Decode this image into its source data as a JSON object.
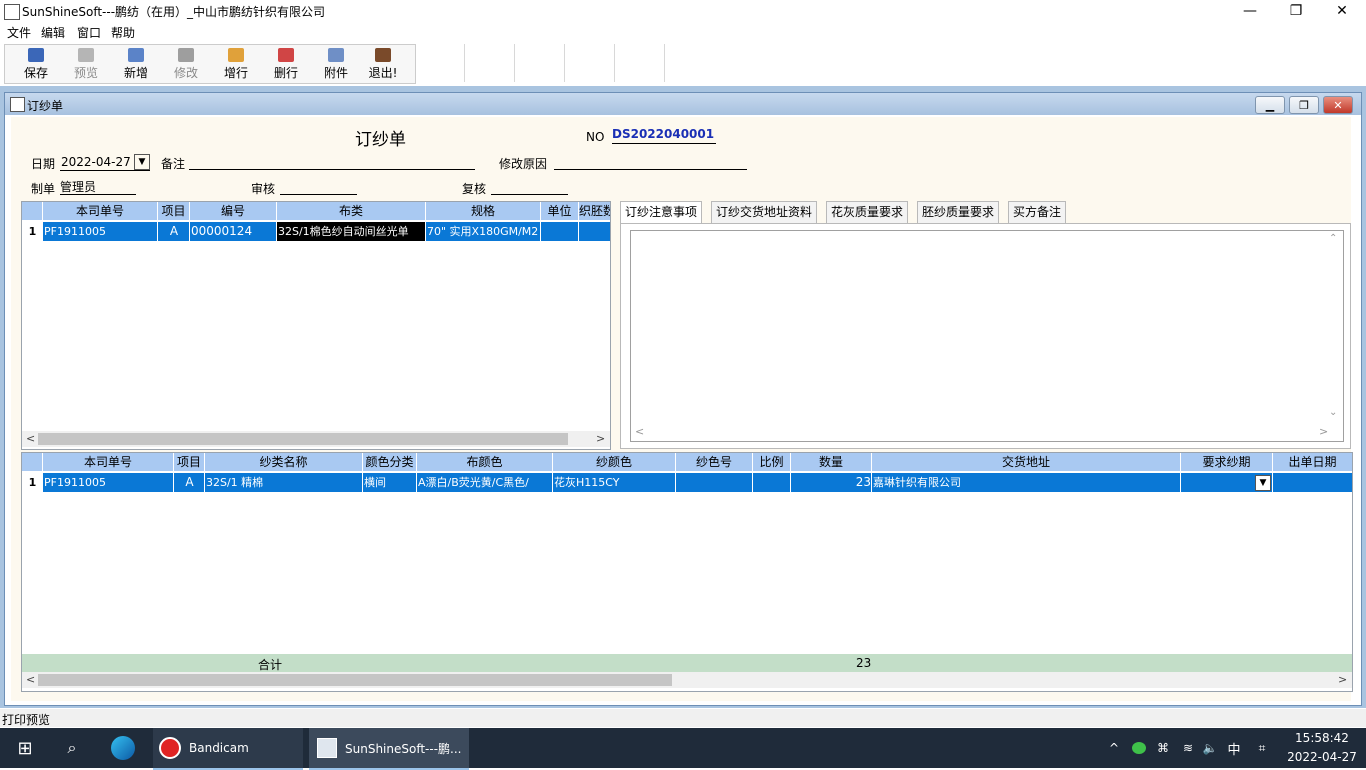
{
  "window": {
    "title": "SunShineSoft---鹏纺（在用）_中山市鹏纺针织有限公司"
  },
  "menu": [
    "文件",
    "编辑",
    "窗口",
    "帮助"
  ],
  "toolbar": [
    {
      "label": "保存",
      "icon": "save-icon",
      "enabled": true
    },
    {
      "label": "预览",
      "icon": "preview-icon",
      "enabled": false
    },
    {
      "label": "新增",
      "icon": "add-icon",
      "enabled": true
    },
    {
      "label": "修改",
      "icon": "edit-icon",
      "enabled": false
    },
    {
      "label": "增行",
      "icon": "add-row-icon",
      "enabled": true
    },
    {
      "label": "删行",
      "icon": "delete-row-icon",
      "enabled": true
    },
    {
      "label": "附件",
      "icon": "attachment-icon",
      "enabled": true
    },
    {
      "label": "退出!",
      "icon": "exit-icon",
      "enabled": true
    }
  ],
  "child": {
    "title": "订纱单"
  },
  "form": {
    "heading": "订纱单",
    "no_label": "NO",
    "no_value": "DS2022040001",
    "date_label": "日期",
    "date_value": "2022-04-27",
    "remark_label": "备注",
    "reason_label": "修改原因",
    "maker_label": "制单",
    "maker_value": "管理员",
    "audit_label": "审核",
    "recheck_label": "复核"
  },
  "top_grid": {
    "columns": [
      "本司单号",
      "项目",
      "编号",
      "布类",
      "规格",
      "单位",
      "织胚数"
    ],
    "rows": [
      {
        "num": "1",
        "order": "PF1911005",
        "item": "A",
        "code": "00000124",
        "fabric": "32S/1棉色纱自动间丝光单",
        "spec": "70\" 实用X180GM/M2",
        "unit": "",
        "qty": ""
      }
    ]
  },
  "tabs": [
    "订纱注意事项",
    "订纱交货地址资料",
    "花灰质量要求",
    "胚纱质量要求",
    "买方备注"
  ],
  "bottom_grid": {
    "columns": [
      "本司单号",
      "项目",
      "纱类名称",
      "颜色分类",
      "布颜色",
      "纱颜色",
      "纱色号",
      "比例",
      "数量",
      "交货地址",
      "要求纱期",
      "出单日期"
    ],
    "rows": [
      {
        "num": "1",
        "order": "PF1911005",
        "item": "A",
        "yarn": "32S/1 精棉",
        "color_cat": "横间",
        "fabric_color": "A漂白/B荧光黄/C黑色/",
        "yarn_color": "花灰H115CY",
        "yarn_no": "",
        "ratio": "",
        "qty": "23",
        "address": "嘉琳针织有限公司",
        "req_date": "",
        "out_date": ""
      }
    ],
    "total_label": "合计",
    "total_qty": "23"
  },
  "status": "打印预览",
  "taskbar": {
    "apps": [
      "Bandicam",
      "SunShineSoft---鹏..."
    ],
    "ime": "中",
    "time": "15:58:42",
    "date": "2022-04-27"
  }
}
